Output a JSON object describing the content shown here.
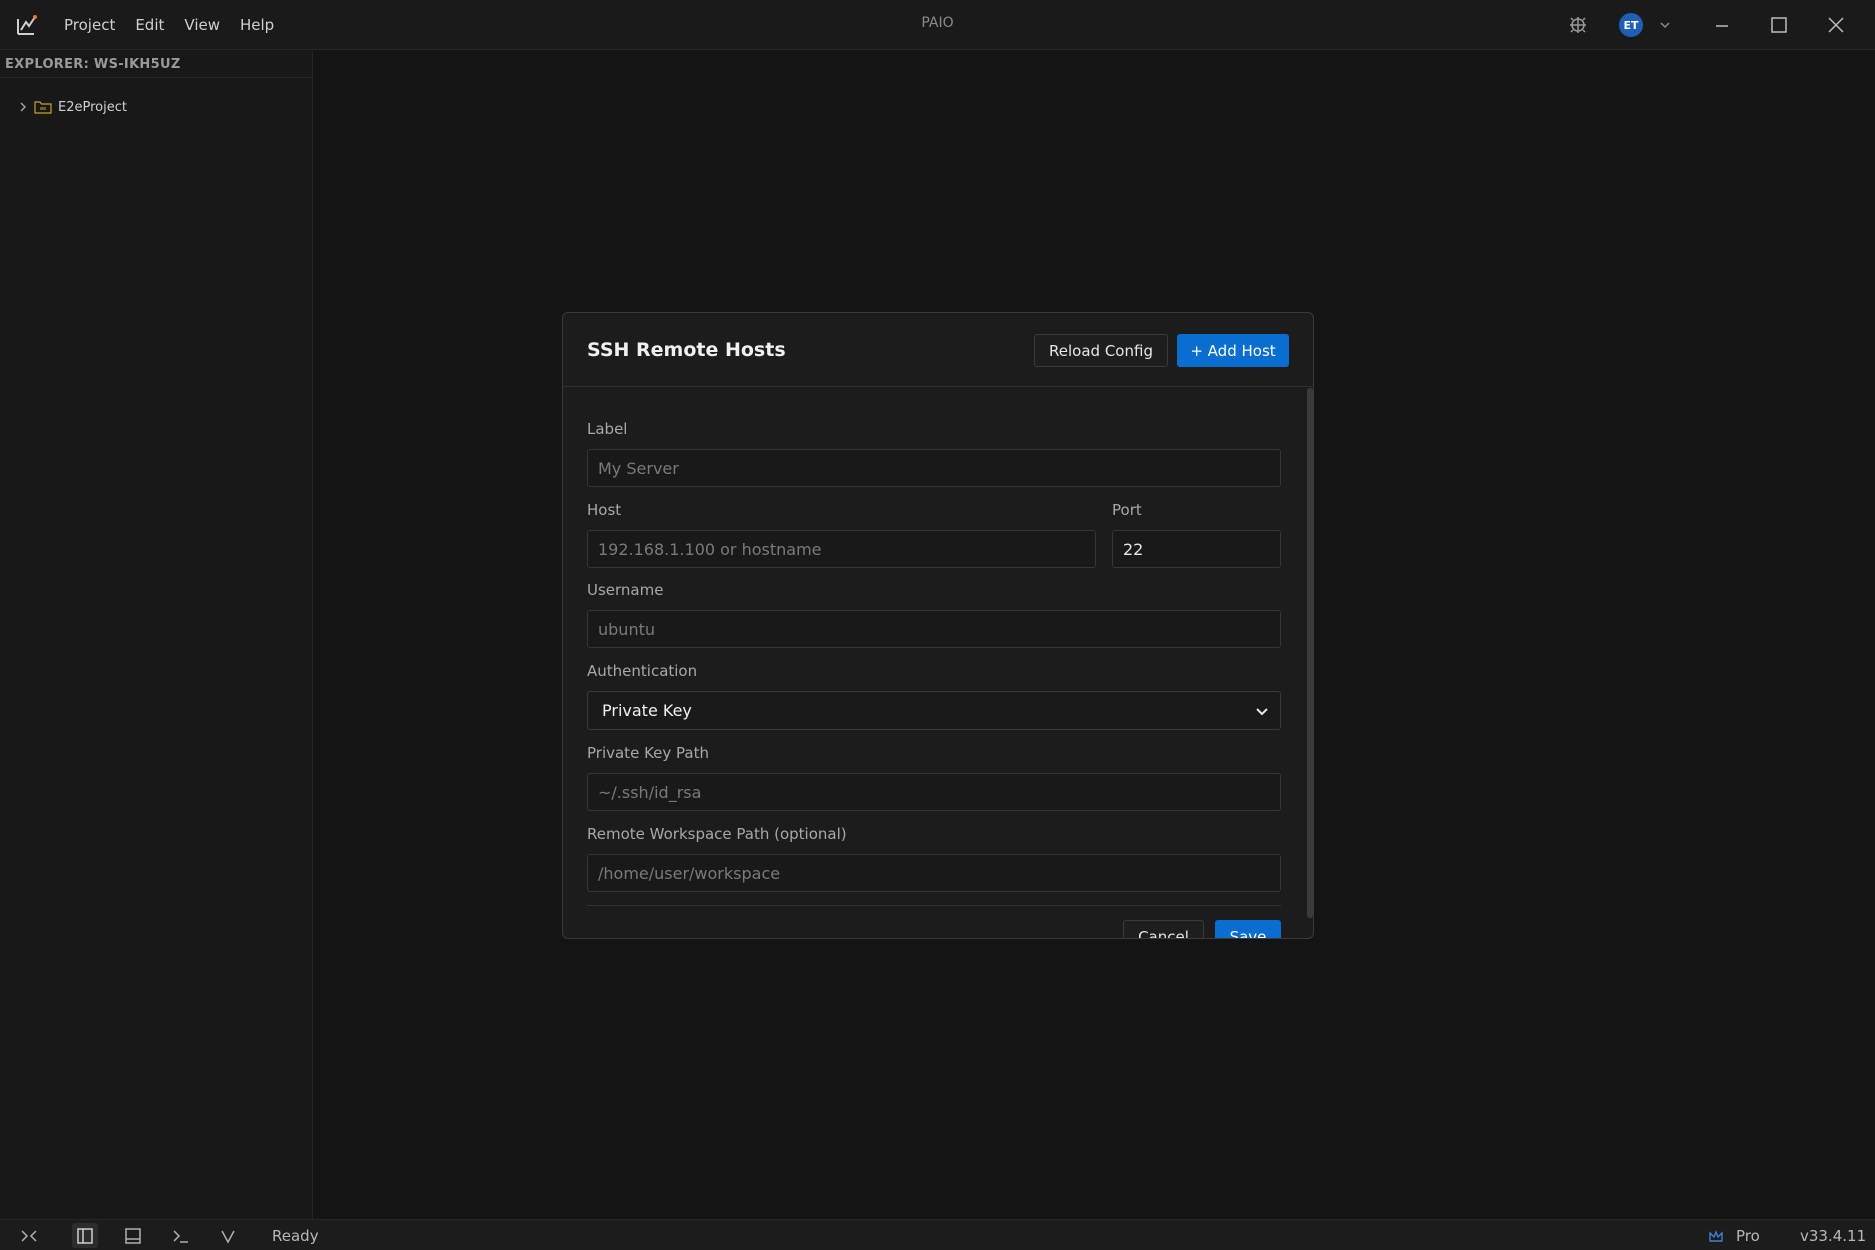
{
  "titlebar": {
    "title": "PAIO",
    "menu": [
      "Project",
      "Edit",
      "View",
      "Help"
    ],
    "avatar_initials": "ET",
    "icons": [
      "app-logo-icon",
      "debug-icon",
      "chevron-down-icon",
      "minimize-icon",
      "maximize-icon",
      "close-icon"
    ]
  },
  "sidebar": {
    "header": "EXPLORER: WS-IKH5UZ",
    "items": [
      {
        "label": "E2eProject",
        "icon": "folder-icon",
        "expanded": false
      }
    ]
  },
  "dialog": {
    "title": "SSH Remote Hosts",
    "reload_label": "Reload Config",
    "add_label": "+ Add Host",
    "fields": {
      "label": {
        "label": "Label",
        "value": "",
        "placeholder": "My Server"
      },
      "host": {
        "label": "Host",
        "value": "",
        "placeholder": "192.168.1.100 or hostname"
      },
      "port": {
        "label": "Port",
        "value": "22",
        "placeholder": ""
      },
      "username": {
        "label": "Username",
        "value": "",
        "placeholder": "ubuntu"
      },
      "auth": {
        "label": "Authentication",
        "selected": "Private Key"
      },
      "key_path": {
        "label": "Private Key Path",
        "value": "",
        "placeholder": "~/.ssh/id_rsa"
      },
      "workspace": {
        "label": "Remote Workspace Path (optional)",
        "value": "",
        "placeholder": "/home/user/workspace"
      }
    },
    "cancel_label": "Cancel",
    "save_label": "Save"
  },
  "statusbar": {
    "status": "Ready",
    "plan": "Pro",
    "version": "v33.4.11"
  },
  "colors": {
    "accent": "#0a6ed1",
    "background": "#141414",
    "folder": "#c9a227"
  }
}
